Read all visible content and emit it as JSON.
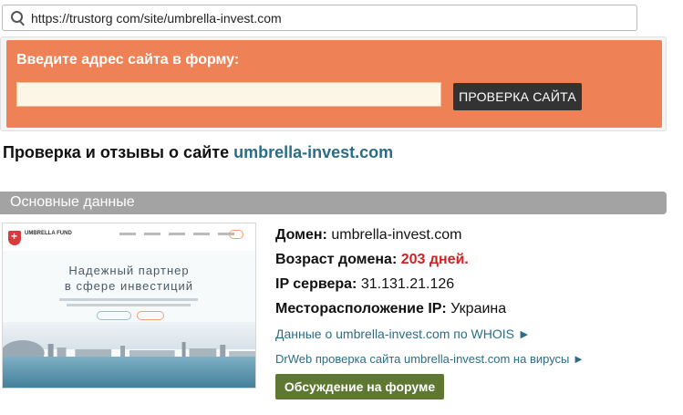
{
  "address_bar": {
    "url": "https://trustorg com/site/umbrella-invest.com",
    "icon": "search-icon"
  },
  "form": {
    "label": "Введите адрес сайта в форму:",
    "input_value": "",
    "input_placeholder": "",
    "button_label": "ПРОВЕРКА САЙТА"
  },
  "page": {
    "title_prefix": "Проверка и отзывы о сайте",
    "title_domain": "umbrella-invest.com"
  },
  "section": {
    "title": "Основные данные"
  },
  "thumbnail": {
    "brand": "UMBRELLA FUND",
    "hero_line1": "Надежный партнер",
    "hero_line2": "в сфере инвестиций"
  },
  "info": {
    "domain_label": "Домен:",
    "domain_value": "umbrella-invest.com",
    "age_label": "Возраст домена:",
    "age_value": "203 дней.",
    "ip_label": "IP сервера:",
    "ip_value": "31.131.21.126",
    "location_label": "Месторасположение IP:",
    "location_value": "Украина",
    "whois_link": "Данные о umbrella-invest.com по WHOIS ►",
    "drweb_link": "DrWeb проверка сайта umbrella-invest.com на вирусы ►",
    "forum_button": "Обсуждение на форуме"
  },
  "colors": {
    "form_bg": "#ef8156",
    "link": "#2b6d86",
    "age_red": "#d42020",
    "forum_btn": "#5e7733",
    "section_bar": "#a3a3a3"
  }
}
